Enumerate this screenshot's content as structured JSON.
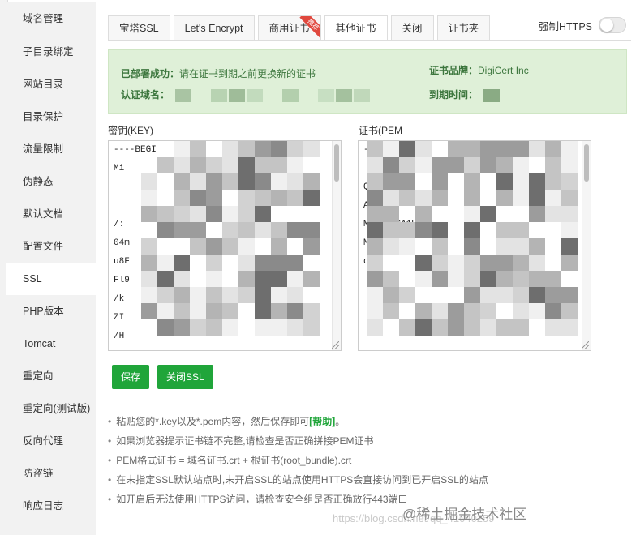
{
  "sidebar": {
    "items": [
      {
        "label": "域名管理"
      },
      {
        "label": "子目录绑定"
      },
      {
        "label": "网站目录"
      },
      {
        "label": "目录保护"
      },
      {
        "label": "流量限制"
      },
      {
        "label": "伪静态"
      },
      {
        "label": "默认文档"
      },
      {
        "label": "配置文件"
      },
      {
        "label": "SSL",
        "active": true
      },
      {
        "label": "PHP版本"
      },
      {
        "label": "Tomcat"
      },
      {
        "label": "重定向"
      },
      {
        "label": "重定向(测试版)"
      },
      {
        "label": "反向代理"
      },
      {
        "label": "防盗链"
      },
      {
        "label": "响应日志"
      }
    ]
  },
  "tabs": [
    {
      "label": "宝塔SSL"
    },
    {
      "label": "Let's Encrypt"
    },
    {
      "label": "商用证书",
      "badge": "推荐"
    },
    {
      "label": "其他证书",
      "active": true
    },
    {
      "label": "关闭"
    },
    {
      "label": "证书夹"
    }
  ],
  "https_toggle": {
    "label": "强制HTTPS",
    "on": false
  },
  "status": {
    "deployed_label": "已部署成功：",
    "deployed_text": "请在证书到期之前更换新的证书",
    "domain_label": "认证域名：",
    "brand_label": "证书品牌：",
    "brand_value": "DigiCert Inc",
    "expire_label": "到期时间："
  },
  "key_field": {
    "label": "密钥(KEY)",
    "lines": [
      "----BEGI",
      "Mi",
      "",
      "",
      "/:",
      "04m",
      "u8F",
      "Fl9",
      "/k",
      "ZI",
      "/H",
      "/5T1S"
    ]
  },
  "cert_field": {
    "label": "证书(PEM",
    "lines": [
      "-----BE",
      "",
      "QC",
      "AQs",
      "MQ                    VU          GA1U",
      "MRC",
      "d3",
      "",
      "",
      "",
      "",
      "L           wo"
    ]
  },
  "buttons": {
    "save": "保存",
    "close_ssl": "关闭SSL"
  },
  "notes": [
    {
      "text": "粘贴您的*.key以及*.pem内容，然后保存即可",
      "help": "[帮助]",
      "tail": "。"
    },
    {
      "text": "如果浏览器提示证书链不完整,请检查是否正确拼接PEM证书"
    },
    {
      "text": "PEM格式证书 = 域名证书.crt + 根证书(root_bundle).crt"
    },
    {
      "text": "在未指定SSL默认站点时,未开启SSL的站点使用HTTPS会直接访问到已开启SSL的站点"
    },
    {
      "text": "如开启后无法使用HTTPS访问，请检查安全组是否正确放行443端口"
    }
  ],
  "watermark": {
    "url": "https://blog.csdn.net/qq_41040259",
    "brand": "@稀土掘金技术社区"
  },
  "colors": {
    "accent": "#20a53a",
    "success_bg": "#dff0d8",
    "success_text": "#3c763d"
  }
}
